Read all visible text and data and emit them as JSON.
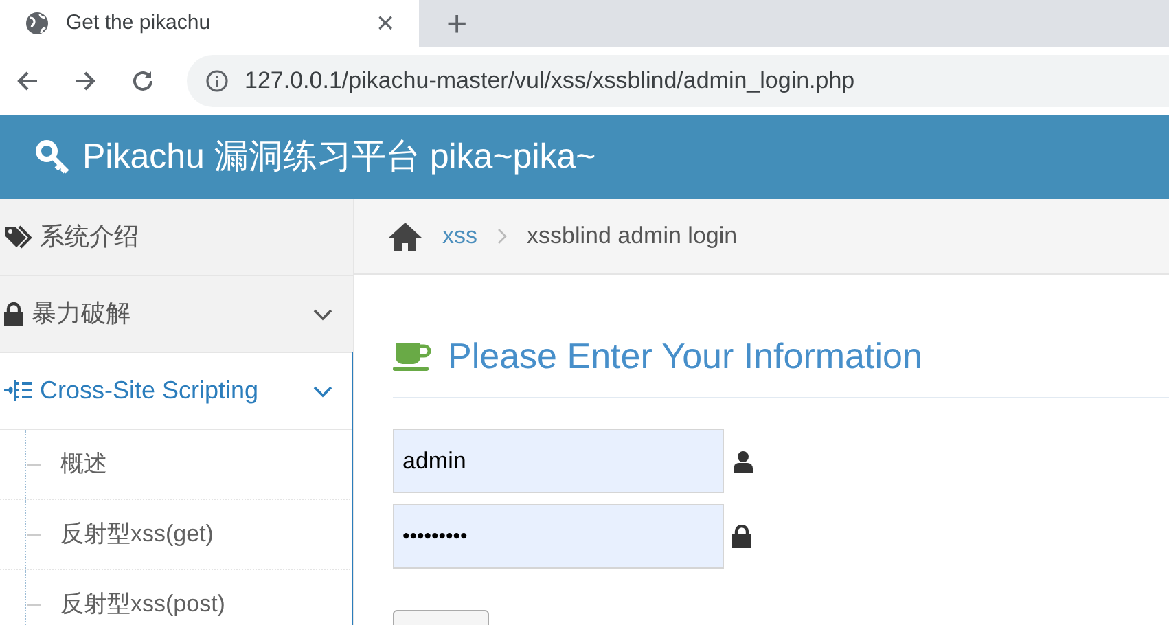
{
  "browser": {
    "tab_title": "Get the pikachu",
    "close": "×",
    "new_tab": "+",
    "url": "127.0.0.1/pikachu-master/vul/xss/xssblind/admin_login.php"
  },
  "header": {
    "title": "Pikachu 漏洞练习平台 pika~pika~"
  },
  "sidebar": {
    "items": [
      {
        "label": "系统介绍",
        "selected": false,
        "kind": "link"
      },
      {
        "label": "暴力破解",
        "selected": false,
        "kind": "group"
      },
      {
        "label": "Cross-Site Scripting",
        "selected": true,
        "kind": "group",
        "children": [
          {
            "label": "概述"
          },
          {
            "label": "反射型xss(get)"
          },
          {
            "label": "反射型xss(post)"
          }
        ]
      }
    ]
  },
  "breadcrumb": [
    {
      "label": "xss",
      "kind": "link"
    },
    {
      "label": "xssblind admin login",
      "kind": "current"
    }
  ],
  "form": {
    "heading": "Please Enter Your Information",
    "username": "admin",
    "password": "•••••••••"
  }
}
